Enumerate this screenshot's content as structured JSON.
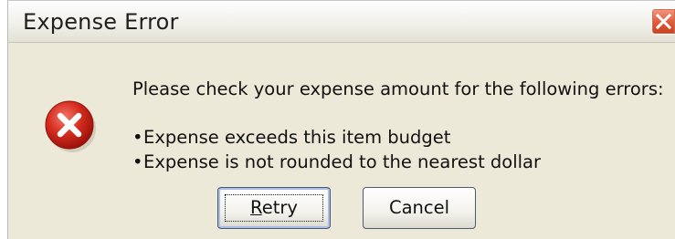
{
  "window": {
    "title": "Expense Error",
    "close_icon": "close-icon"
  },
  "icon": {
    "name": "error-icon",
    "color": "#d42b1e"
  },
  "message": "Please check your expense amount for the following errors:",
  "errors": [
    "Expense exceeds this item budget",
    "Expense is not rounded to the nearest dollar"
  ],
  "buttons": {
    "retry_mnemonic": "R",
    "retry_rest": "etry",
    "cancel": "Cancel"
  }
}
